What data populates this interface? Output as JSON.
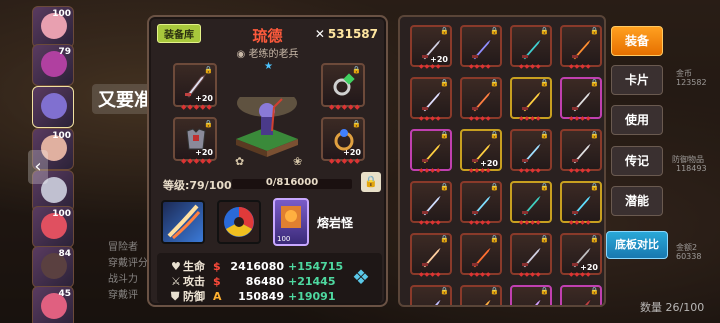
{
  "background": {
    "speech": "又要准",
    "hints": [
      "冒险者",
      "穿戴评分",
      "战斗力",
      "穿戴评",
      "狂乱",
      "圣火"
    ],
    "right_labels": [
      "金币",
      "123582",
      "防御物品",
      "118493",
      "金额2",
      "60338"
    ],
    "bottom_note": "数量 26/100"
  },
  "hero_strip": {
    "levels": [
      "100",
      "79",
      "",
      "100",
      "",
      "100",
      "84",
      "45"
    ]
  },
  "panel": {
    "tag": "装备库",
    "name": "琉德",
    "title": "老练的老兵",
    "power": "531587",
    "gear_plus": "+20",
    "level_label": "等级:79/100",
    "exp": "0/816000",
    "skill_name": "熔岩怪",
    "skill_card_num": "100",
    "stats": [
      {
        "icon": "♥",
        "label": "生命",
        "grade": "$",
        "value": "2416080",
        "bonus": "+154715"
      },
      {
        "icon": "⚔",
        "label": "攻击",
        "grade": "$",
        "value": "86480",
        "bonus": "+21445"
      },
      {
        "icon": "⛊",
        "label": "防御",
        "grade": "A",
        "value": "150849",
        "bonus": "+19091"
      }
    ]
  },
  "inventory": {
    "plus": "+20",
    "items": [
      {
        "plus": true,
        "color": "#d0d0e0"
      },
      {
        "plus": false,
        "color": "#9090ff"
      },
      {
        "plus": false,
        "color": "#40d0d0"
      },
      {
        "plus": false,
        "color": "#ff9030"
      },
      {
        "plus": false,
        "color": "#e0e0ff"
      },
      {
        "plus": false,
        "color": "#ff8040"
      },
      {
        "plus": false,
        "color": "#ffd040"
      },
      {
        "plus": false,
        "color": "#e0e0e0"
      },
      {
        "plus": false,
        "color": "#ffd040"
      },
      {
        "plus": true,
        "color": "#ffd040"
      },
      {
        "plus": false,
        "color": "#a0e0ff"
      },
      {
        "plus": false,
        "color": "#e0e0e0"
      },
      {
        "plus": false,
        "color": "#d0e0ff"
      },
      {
        "plus": false,
        "color": "#80e0ff"
      },
      {
        "plus": false,
        "color": "#40d0c0"
      },
      {
        "plus": false,
        "color": "#60e0ff"
      },
      {
        "plus": false,
        "color": "#ffd0a0"
      },
      {
        "plus": false,
        "color": "#ff7030"
      },
      {
        "plus": false,
        "color": "#d0d0e0"
      },
      {
        "plus": true,
        "color": "#c0c0c0"
      },
      {
        "plus": false,
        "color": "#c0c0ff"
      },
      {
        "plus": false,
        "color": "#ffb040"
      },
      {
        "plus": false,
        "color": "#d0a0ff"
      },
      {
        "plus": false,
        "color": "#c04040"
      }
    ]
  },
  "tabs": [
    "装备",
    "卡片",
    "使用",
    "传记",
    "潜能"
  ],
  "compare_label": "底板对比"
}
